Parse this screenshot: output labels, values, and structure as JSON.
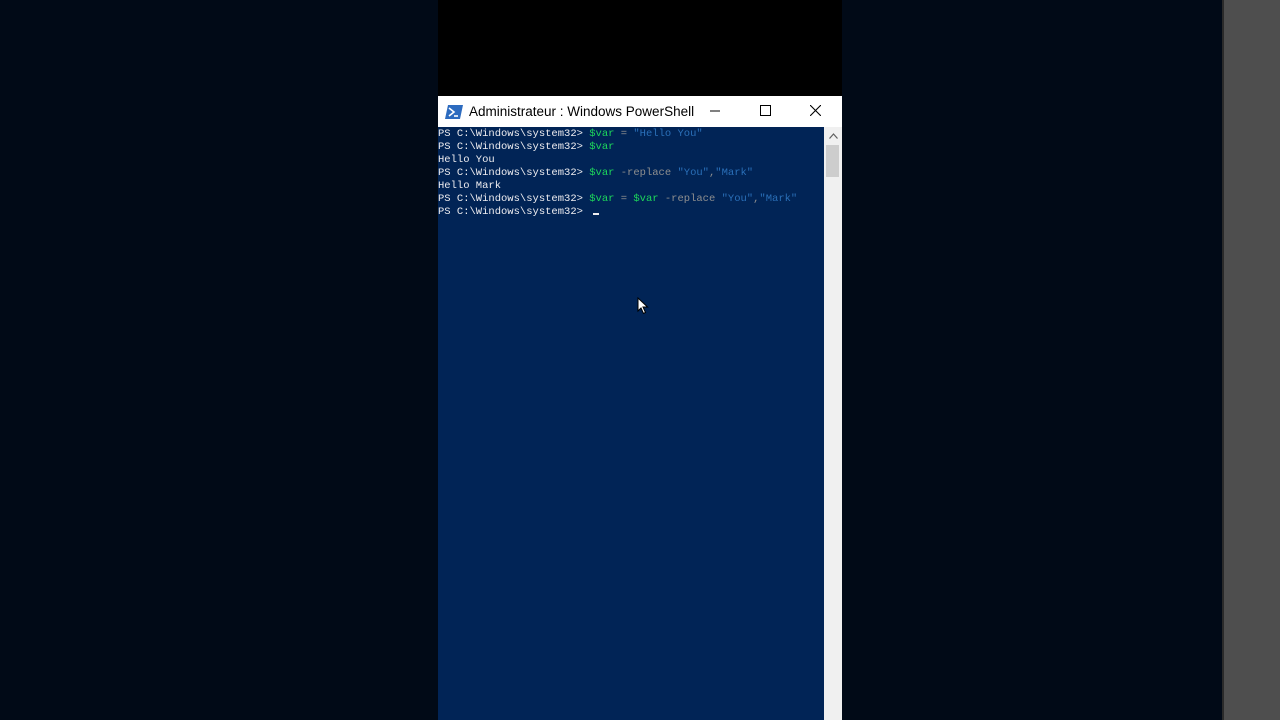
{
  "window": {
    "title": "Administrateur : Windows PowerShell",
    "icon": "powershell-icon",
    "controls": {
      "minimize_icon": "minimize-icon",
      "maximize_icon": "maximize-icon",
      "close_icon": "close-icon"
    }
  },
  "console": {
    "lines": [
      {
        "prompt": "PS C:\\Windows\\system32> ",
        "var1": "$var",
        "op1": " = ",
        "str1": "\"Hello You\""
      },
      {
        "prompt": "PS C:\\Windows\\system32> ",
        "var1": "$var"
      },
      {
        "output": "Hello You"
      },
      {
        "prompt": "PS C:\\Windows\\system32> ",
        "var1": "$var",
        "op1": " -replace ",
        "str1": "\"You\"",
        "op2": ",",
        "str2": "\"Mark\""
      },
      {
        "output": "Hello Mark"
      },
      {
        "prompt": "PS C:\\Windows\\system32> ",
        "var1": "$var",
        "op1": " = ",
        "var2": "$var",
        "op2": " -replace ",
        "str1": "\"You\"",
        "op3": ",",
        "str2": "\"Mark\""
      },
      {
        "prompt": "PS C:\\Windows\\system32> "
      }
    ]
  },
  "colors": {
    "console_background": "#012456",
    "variable": "#1dd75b",
    "string": "#2a6fb8",
    "operator": "#8f8f8f",
    "text": "#eeedf0"
  }
}
